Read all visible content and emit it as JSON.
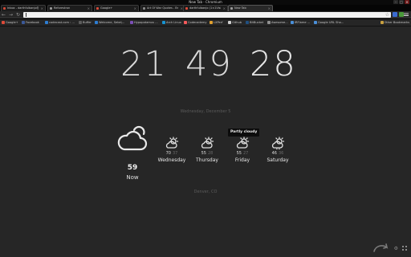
{
  "window": {
    "title": "New Tab - Chromium",
    "controls": [
      "–",
      "□",
      "×"
    ]
  },
  "tabs": [
    {
      "label": "Inbox - darthfulbanjo@gmail.com",
      "favicon_color": "#d14836",
      "active": false
    },
    {
      "label": "Reforestron",
      "favicon_color": "#9a9a9a",
      "active": false
    },
    {
      "label": "Google+",
      "favicon_color": "#dd4b39",
      "active": false
    },
    {
      "label": "Art Of War Quotes - BrainyQuote",
      "favicon_color": "#8a8a8a",
      "active": false
    },
    {
      "label": "darthfulbanjo (1×1Vision) ...",
      "favicon_color": "#dd4b39",
      "active": false
    },
    {
      "label": "New Tab",
      "favicon_color": "#9a9a9a",
      "active": true
    }
  ],
  "toolbar": {
    "back": "←",
    "forward": "→",
    "reload": "↻",
    "star": "☆"
  },
  "extensions_colors": [
    "#3a6bd1",
    "#4a9a3a",
    "#d08a2a"
  ],
  "bookmarks": [
    {
      "label": "Google+",
      "icon_color": "#dd4b39"
    },
    {
      "label": "Facebook",
      "icon_color": "#3b5998"
    },
    {
      "label": "codecast.com : ...",
      "icon_color": "#2d7dd2"
    },
    {
      "label": "Buffer",
      "icon_color": "#5c5c5c"
    },
    {
      "label": "Welcome, Sebe\\...",
      "icon_color": "#2d7dd2"
    },
    {
      "label": "Hypopotamus ...",
      "icon_color": "#7b4fb5"
    },
    {
      "label": "Arch Linux",
      "icon_color": "#1793d1"
    },
    {
      "label": "Codecademy",
      "icon_color": "#f65a5b"
    },
    {
      "label": "LXPerf",
      "icon_color": "#e0a030"
    },
    {
      "label": "Github",
      "icon_color": "#d0d0d0"
    },
    {
      "label": "BitBucket",
      "icon_color": "#205081"
    },
    {
      "label": "Awesome...",
      "icon_color": "#909090"
    },
    {
      "label": "IRFlame ...",
      "icon_color": "#4a8fd8"
    },
    {
      "label": "Google URL Sho...",
      "icon_color": "#4a8fd8"
    }
  ],
  "other_bookmarks": "Other Bookmarks",
  "clock": {
    "hours": "21",
    "minutes": "49",
    "seconds": "28"
  },
  "date": "Wednesday, December 5",
  "now": {
    "temp": "59",
    "label": "Now",
    "icon": "cloud-icon"
  },
  "forecast": [
    {
      "day": "Wednesday",
      "high": "70",
      "low": "37",
      "icon": "partly-cloudy-icon"
    },
    {
      "day": "Thursday",
      "high": "55",
      "low": "28",
      "icon": "partly-cloudy-icon"
    },
    {
      "day": "Friday",
      "high": "55",
      "low": "27",
      "icon": "partly-cloudy-icon"
    },
    {
      "day": "Saturday",
      "high": "46",
      "low": "36",
      "icon": "partly-cloudy-icon"
    }
  ],
  "tooltip": "Partly cloudy",
  "location": "Denver, CO",
  "bottom_icons": [
    "refresh-icon",
    "settings-icon",
    "grid-icon"
  ]
}
